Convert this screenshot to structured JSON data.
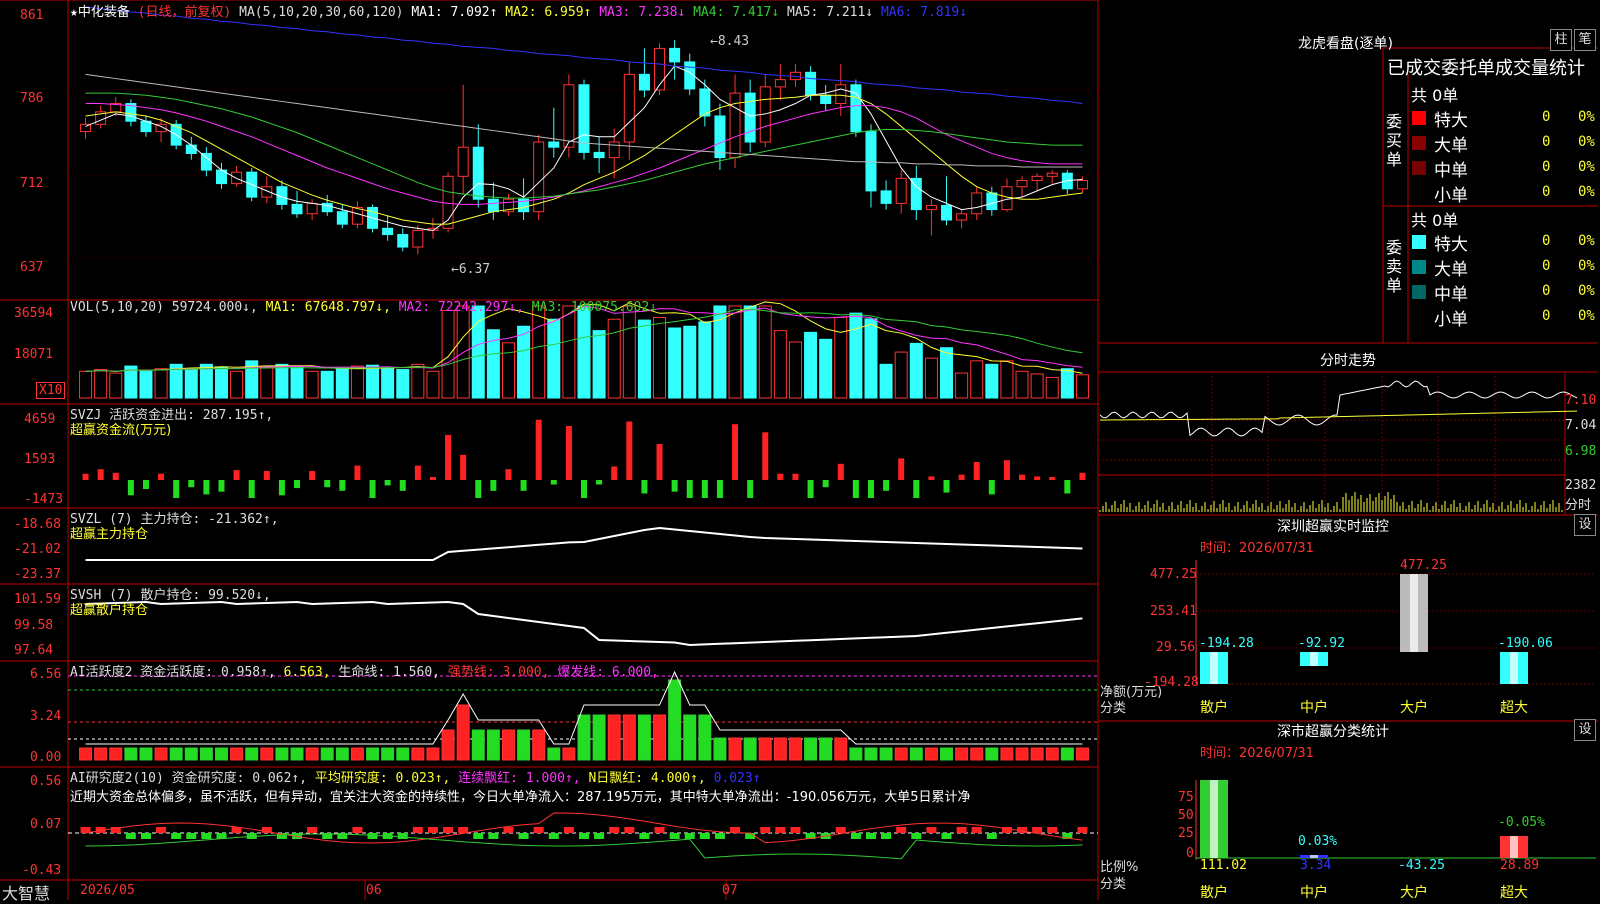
{
  "header": {
    "stock_name": "★中化装备",
    "mode": "(日线，前复权)",
    "ma_label": "MA(5,10,20,30,60,120)",
    "ma1": "MA1: 7.092↑",
    "ma2": "MA2: 6.959↑",
    "ma3": "MA3: 7.238↓",
    "ma4": "MA4: 7.417↓",
    "ma5": "MA5: 7.211↓",
    "ma6": "MA6: 7.819↓"
  },
  "price_axis": [
    "861",
    "786",
    "712",
    "637"
  ],
  "price_marks": {
    "high": "8.43",
    "low": "6.37"
  },
  "vol": {
    "title": "VOL(5,10,20) 59724.000↓,",
    "ma1": "MA1: 67648.797↓,",
    "ma2": "MA2: 72242.297↓,",
    "ma3": "MA3: 100075.602↓",
    "axis": [
      "36594",
      "18071"
    ],
    "unit": "X10"
  },
  "svzj": {
    "title": "SVZJ  活跃资金进出: 287.195↑,",
    "sub": "超赢资金流(万元)",
    "axis": [
      "4659",
      "1593",
      "-1473"
    ]
  },
  "svzl": {
    "title": "SVZL (7) 主力持仓: -21.362↑,",
    "sub": "超赢主力持仓",
    "axis": [
      "-18.68",
      "-21.02",
      "-23.37"
    ]
  },
  "svsh": {
    "title": "SVSH (7) 散户持仓: 99.520↓,",
    "sub": "超赢散户持仓",
    "axis": [
      "101.59",
      "99.58",
      "97.64"
    ]
  },
  "ai1": {
    "title": "AI活跃度2 资金活跃度: 0.958↑,",
    "v2": "6.563,",
    "life": "生命线: 1.560,",
    "strong": "强势线: 3.000,",
    "burst": "爆发线: 6.000,",
    "axis": [
      "6.56",
      "3.24",
      "0.00"
    ]
  },
  "ai2": {
    "title": "AI研究度2(10) 资金研究度: 0.062↑,",
    "avg": "平均研究度: 0.023↑,",
    "red": "连续飘红: 1.000↑,",
    "nred": "N日飘红: 4.000↑,",
    "last": "0.023↑",
    "desc": "近期大资金总体偏多，虽不活跃，但有异动，宜关注大资金的持续性，今日大单净流入：287.195万元，其中特大单净流出：-190.056万元，大单5日累计净",
    "axis": [
      "0.56",
      "0.07",
      "-0.43"
    ]
  },
  "dates": {
    "d1": "2026/05",
    "d2": "06",
    "d3": "07"
  },
  "brand": "大智慧",
  "right": {
    "title": "龙虎看盘(逐单)",
    "btn1": "柱",
    "btn2": "笔",
    "stats_title": "已成交委托单成交量统计",
    "buy_label": "委买单",
    "sell_label": "委卖单",
    "buy_total": "共 0单",
    "sell_total": "共 0单",
    "rows": [
      {
        "label": "特大",
        "v": "0",
        "p": "0%"
      },
      {
        "label": "大单",
        "v": "0",
        "p": "0%"
      },
      {
        "label": "中单",
        "v": "0",
        "p": "0%"
      },
      {
        "label": "小单",
        "v": "0",
        "p": "0%"
      }
    ],
    "intraday_title": "分时走势",
    "intraday_axis": [
      "7.10",
      "7.04",
      "6.98"
    ],
    "intraday_vol": "2382",
    "intraday_unit": "分时",
    "sz_title": "深圳超赢实时监控",
    "set": "设",
    "sz_time": "时间：2026/07/31",
    "sz_axis": [
      "477.25",
      "253.41",
      "29.56",
      "-194.28"
    ],
    "sz_values": [
      "-194.28",
      "-92.92",
      "477.25",
      "-190.06"
    ],
    "sz_ylabel": "净额(万元)",
    "sz_xlabel": "分类",
    "cats": [
      "散户",
      "中户",
      "大户",
      "超大"
    ],
    "sm_title": "深市超赢分类统计",
    "sm_time": "时间：2026/07/31",
    "sm_axis": [
      "75",
      "50",
      "25",
      "0"
    ],
    "sm_pcts": [
      "0.03%",
      "-0.05%"
    ],
    "sm_values": [
      "111.02",
      "3.34",
      "-43.25",
      "28.89"
    ],
    "sm_ylabel": "比例%",
    "sm_xlabel": "分类"
  },
  "chart_data": [
    {
      "type": "candlestick",
      "ohlc": [
        [
          7.55,
          7.68,
          7.48,
          7.62
        ],
        [
          7.62,
          7.8,
          7.58,
          7.74
        ],
        [
          7.74,
          7.88,
          7.7,
          7.82
        ],
        [
          7.82,
          7.86,
          7.6,
          7.65
        ],
        [
          7.65,
          7.7,
          7.5,
          7.55
        ],
        [
          7.55,
          7.68,
          7.45,
          7.62
        ],
        [
          7.62,
          7.66,
          7.38,
          7.42
        ],
        [
          7.42,
          7.5,
          7.28,
          7.34
        ],
        [
          7.34,
          7.4,
          7.12,
          7.18
        ],
        [
          7.18,
          7.25,
          7.0,
          7.05
        ],
        [
          7.05,
          7.22,
          7.02,
          7.16
        ],
        [
          7.16,
          7.2,
          6.88,
          6.92
        ],
        [
          6.92,
          7.12,
          6.86,
          7.02
        ],
        [
          7.02,
          7.08,
          6.8,
          6.85
        ],
        [
          6.85,
          6.98,
          6.72,
          6.76
        ],
        [
          6.76,
          6.9,
          6.7,
          6.86
        ],
        [
          6.86,
          6.94,
          6.74,
          6.78
        ],
        [
          6.78,
          6.85,
          6.62,
          6.66
        ],
        [
          6.66,
          6.88,
          6.62,
          6.82
        ],
        [
          6.82,
          6.85,
          6.58,
          6.62
        ],
        [
          6.62,
          6.74,
          6.5,
          6.56
        ],
        [
          6.56,
          6.62,
          6.4,
          6.44
        ],
        [
          6.44,
          6.65,
          6.37,
          6.6
        ],
        [
          6.6,
          6.72,
          6.52,
          6.62
        ],
        [
          6.62,
          7.16,
          6.58,
          7.12
        ],
        [
          7.12,
          8.0,
          6.95,
          7.4
        ],
        [
          7.4,
          7.62,
          6.82,
          6.9
        ],
        [
          6.9,
          7.06,
          6.7,
          6.78
        ],
        [
          6.78,
          6.95,
          6.74,
          6.9
        ],
        [
          6.9,
          7.1,
          6.7,
          6.78
        ],
        [
          6.78,
          7.52,
          6.7,
          7.45
        ],
        [
          7.45,
          7.78,
          7.3,
          7.4
        ],
        [
          7.4,
          8.1,
          7.3,
          8.0
        ],
        [
          8.0,
          8.05,
          7.28,
          7.35
        ],
        [
          7.35,
          7.5,
          7.15,
          7.3
        ],
        [
          7.3,
          7.58,
          7.1,
          7.45
        ],
        [
          7.45,
          8.22,
          7.28,
          8.1
        ],
        [
          8.1,
          8.35,
          7.88,
          7.95
        ],
        [
          7.95,
          8.4,
          7.9,
          8.35
        ],
        [
          8.35,
          8.43,
          8.05,
          8.22
        ],
        [
          8.22,
          8.3,
          7.9,
          7.96
        ],
        [
          7.96,
          8.05,
          7.6,
          7.7
        ],
        [
          7.7,
          7.82,
          7.18,
          7.3
        ],
        [
          7.3,
          8.1,
          7.2,
          7.92
        ],
        [
          7.92,
          8.05,
          7.35,
          7.45
        ],
        [
          7.45,
          8.1,
          7.4,
          7.98
        ],
        [
          7.98,
          8.2,
          7.85,
          8.05
        ],
        [
          8.05,
          8.2,
          7.98,
          8.12
        ],
        [
          8.12,
          8.18,
          7.85,
          7.9
        ],
        [
          7.9,
          8.0,
          7.75,
          7.82
        ],
        [
          7.82,
          8.2,
          7.7,
          8.0
        ],
        [
          8.0,
          8.05,
          7.5,
          7.55
        ],
        [
          7.55,
          7.62,
          6.82,
          6.98
        ],
        [
          6.98,
          7.08,
          6.8,
          6.86
        ],
        [
          6.86,
          7.18,
          6.76,
          7.1
        ],
        [
          7.1,
          7.22,
          6.7,
          6.8
        ],
        [
          6.8,
          6.9,
          6.55,
          6.84
        ],
        [
          6.84,
          7.12,
          6.65,
          6.7
        ],
        [
          6.7,
          6.8,
          6.62,
          6.76
        ],
        [
          6.76,
          7.02,
          6.7,
          6.96
        ],
        [
          6.96,
          7.02,
          6.74,
          6.8
        ],
        [
          6.8,
          7.1,
          6.78,
          7.02
        ],
        [
          7.02,
          7.12,
          6.92,
          7.08
        ],
        [
          7.08,
          7.15,
          6.98,
          7.12
        ],
        [
          7.12,
          7.18,
          7.05,
          7.15
        ],
        [
          7.15,
          7.18,
          6.95,
          7.0
        ],
        [
          7.0,
          7.12,
          6.96,
          7.08
        ]
      ],
      "ma": {
        "MA1": [
          7.6,
          7.66,
          7.72,
          7.7,
          7.65,
          7.6,
          7.52,
          7.42,
          7.3,
          7.18,
          7.1,
          7.04,
          6.98,
          6.92,
          6.88,
          6.86,
          6.84,
          6.8,
          6.76,
          6.72,
          6.68,
          6.64,
          6.62,
          6.6,
          6.7,
          6.92,
          7.05,
          7.04,
          7.0,
          6.92,
          7.06,
          7.2,
          7.45,
          7.52,
          7.5,
          7.5,
          7.64,
          7.78,
          8.0,
          8.18,
          8.12,
          8.0,
          7.86,
          7.78,
          7.7,
          7.72,
          7.76,
          7.82,
          7.9,
          7.92,
          7.96,
          7.92,
          7.72,
          7.46,
          7.2,
          7.02,
          6.92,
          6.86,
          6.8,
          6.82,
          6.86,
          6.9,
          6.92,
          6.98,
          7.04,
          7.08,
          7.09
        ],
        "MA2": [
          7.7,
          7.72,
          7.74,
          7.72,
          7.7,
          7.66,
          7.6,
          7.54,
          7.46,
          7.38,
          7.3,
          7.22,
          7.14,
          7.06,
          7.0,
          6.94,
          6.89,
          6.85,
          6.81,
          6.78,
          6.74,
          6.7,
          6.68,
          6.66,
          6.66,
          6.7,
          6.74,
          6.78,
          6.8,
          6.82,
          6.86,
          6.9,
          6.96,
          7.04,
          7.1,
          7.16,
          7.24,
          7.32,
          7.42,
          7.52,
          7.62,
          7.72,
          7.78,
          7.82,
          7.84,
          7.86,
          7.87,
          7.88,
          7.9,
          7.9,
          7.9,
          7.88,
          7.82,
          7.72,
          7.6,
          7.48,
          7.36,
          7.24,
          7.12,
          7.02,
          6.96,
          6.92,
          6.9,
          6.9,
          6.92,
          6.94,
          6.96
        ],
        "MA3": [
          7.82,
          7.82,
          7.81,
          7.8,
          7.78,
          7.76,
          7.73,
          7.69,
          7.65,
          7.6,
          7.55,
          7.5,
          7.44,
          7.38,
          7.32,
          7.26,
          7.2,
          7.15,
          7.1,
          7.05,
          7.0,
          6.96,
          6.92,
          6.88,
          6.86,
          6.85,
          6.85,
          6.86,
          6.87,
          6.88,
          6.9,
          6.92,
          6.95,
          6.98,
          7.02,
          7.06,
          7.1,
          7.15,
          7.2,
          7.26,
          7.32,
          7.38,
          7.44,
          7.5,
          7.55,
          7.6,
          7.64,
          7.68,
          7.72,
          7.75,
          7.78,
          7.8,
          7.8,
          7.78,
          7.74,
          7.68,
          7.6,
          7.52,
          7.46,
          7.4,
          7.34,
          7.3,
          7.27,
          7.25,
          7.24,
          7.24,
          7.24
        ],
        "MA4": [
          7.92,
          7.92,
          7.92,
          7.91,
          7.9,
          7.88,
          7.86,
          7.83,
          7.8,
          7.77,
          7.73,
          7.69,
          7.64,
          7.59,
          7.54,
          7.48,
          7.42,
          7.36,
          7.3,
          7.24,
          7.18,
          7.12,
          7.06,
          7.01,
          6.97,
          6.95,
          6.93,
          6.92,
          6.91,
          6.91,
          6.92,
          6.93,
          6.95,
          6.97,
          6.99,
          7.02,
          7.05,
          7.08,
          7.12,
          7.16,
          7.2,
          7.24,
          7.27,
          7.3,
          7.33,
          7.36,
          7.39,
          7.42,
          7.45,
          7.48,
          7.51,
          7.54,
          7.56,
          7.57,
          7.57,
          7.56,
          7.55,
          7.53,
          7.51,
          7.49,
          7.47,
          7.45,
          7.44,
          7.43,
          7.42,
          7.42,
          7.42
        ],
        "MA5": [
          8.1,
          8.08,
          8.06,
          8.04,
          8.02,
          8.0,
          7.98,
          7.96,
          7.94,
          7.92,
          7.9,
          7.88,
          7.86,
          7.84,
          7.82,
          7.8,
          7.78,
          7.76,
          7.74,
          7.72,
          7.7,
          7.68,
          7.66,
          7.64,
          7.62,
          7.6,
          7.58,
          7.56,
          7.54,
          7.52,
          7.5,
          7.48,
          7.46,
          7.44,
          7.43,
          7.42,
          7.41,
          7.4,
          7.39,
          7.38,
          7.37,
          7.36,
          7.35,
          7.34,
          7.33,
          7.32,
          7.31,
          7.3,
          7.29,
          7.28,
          7.27,
          7.26,
          7.26,
          7.25,
          7.25,
          7.24,
          7.24,
          7.23,
          7.23,
          7.22,
          7.22,
          7.22,
          7.21,
          7.21,
          7.21,
          7.21,
          7.21
        ],
        "MA6": [
          8.75,
          8.73,
          8.72,
          8.7,
          8.69,
          8.67,
          8.66,
          8.64,
          8.63,
          8.61,
          8.6,
          8.58,
          8.57,
          8.55,
          8.54,
          8.52,
          8.51,
          8.49,
          8.48,
          8.46,
          8.45,
          8.43,
          8.42,
          8.4,
          8.39,
          8.37,
          8.36,
          8.35,
          8.33,
          8.32,
          8.3,
          8.29,
          8.28,
          8.26,
          8.25,
          8.24,
          8.22,
          8.21,
          8.2,
          8.18,
          8.17,
          8.16,
          8.14,
          8.13,
          8.12,
          8.1,
          8.09,
          8.08,
          8.06,
          8.05,
          8.04,
          8.03,
          8.01,
          8.0,
          7.99,
          7.97,
          7.96,
          7.95,
          7.93,
          7.92,
          7.91,
          7.89,
          7.88,
          7.87,
          7.85,
          7.84,
          7.82
        ]
      }
    }
  ]
}
